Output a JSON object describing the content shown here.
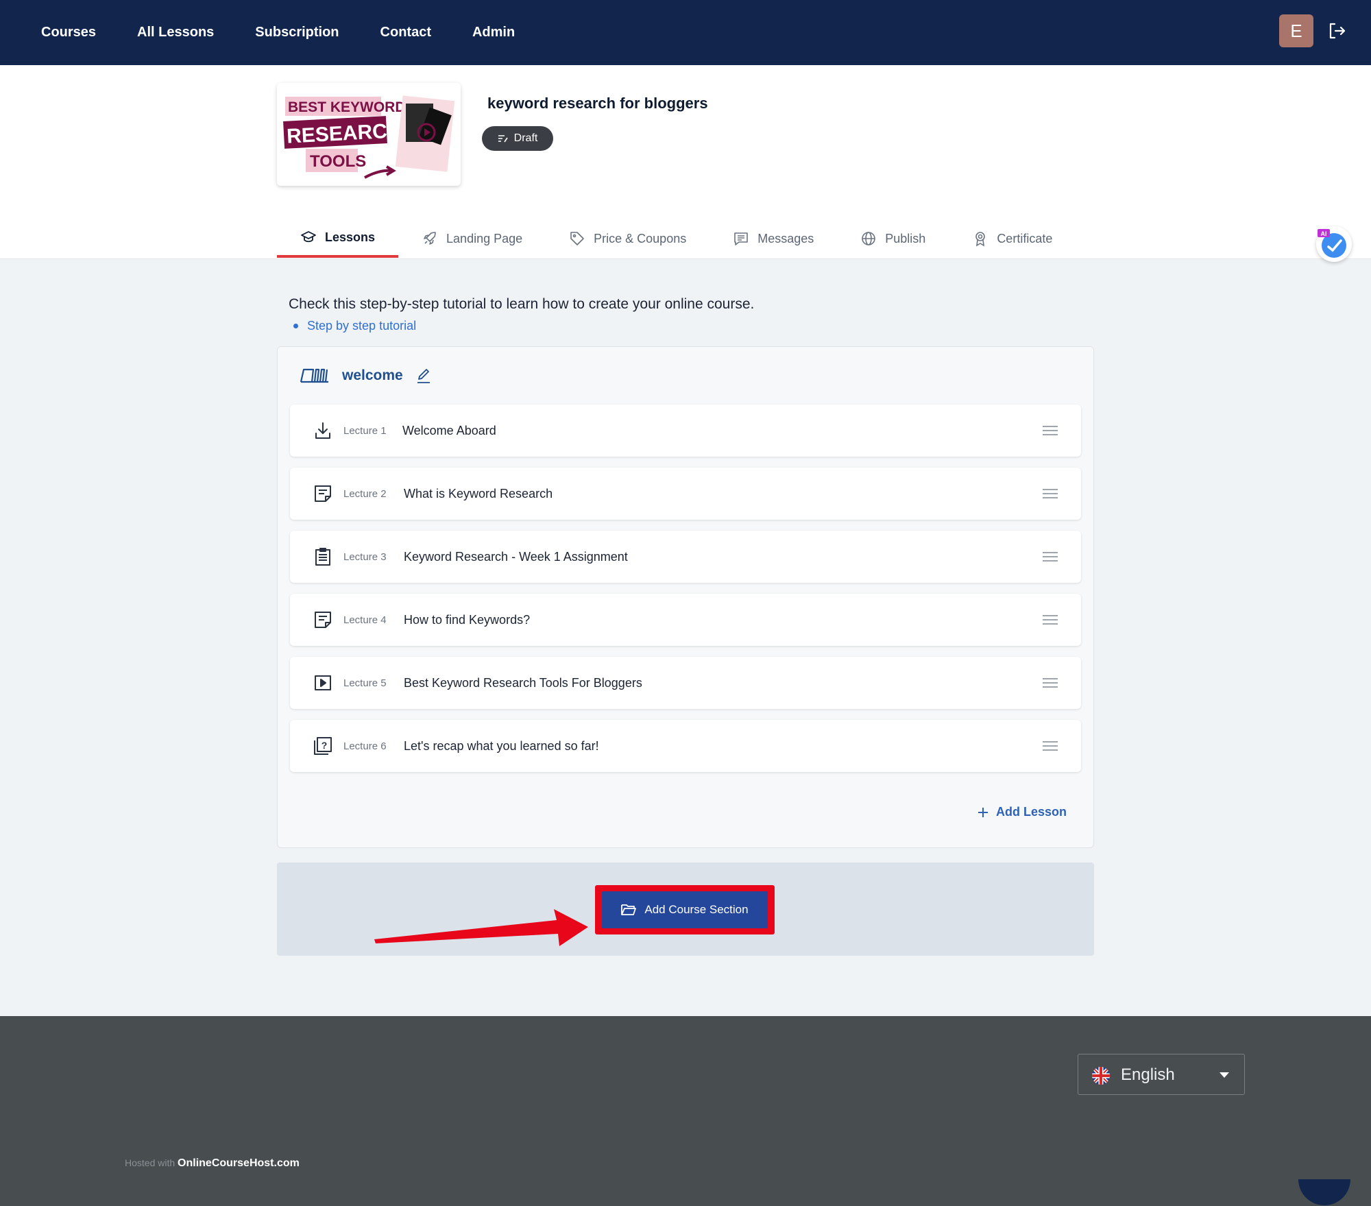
{
  "topnav": {
    "links": [
      "Courses",
      "All Lessons",
      "Subscription",
      "Contact",
      "Admin"
    ],
    "avatar_initial": "E"
  },
  "course": {
    "title": "keyword research for bloggers",
    "status": "Draft",
    "thumbnail_text": [
      "BEST KEYWORD",
      "RESEARCH",
      "TOOLS"
    ]
  },
  "tabs": [
    {
      "label": "Lessons",
      "icon": "graduation-cap-icon",
      "active": true
    },
    {
      "label": "Landing Page",
      "icon": "rocket-icon",
      "active": false
    },
    {
      "label": "Price & Coupons",
      "icon": "tag-icon",
      "active": false
    },
    {
      "label": "Messages",
      "icon": "message-icon",
      "active": false
    },
    {
      "label": "Publish",
      "icon": "globe-icon",
      "active": false
    },
    {
      "label": "Certificate",
      "icon": "award-icon",
      "active": false
    }
  ],
  "ai_badge_label": "AI",
  "intro": {
    "text": "Check this step-by-step tutorial to learn how to create your online course.",
    "link": "Step by step tutorial"
  },
  "section": {
    "name": "welcome",
    "lectures": [
      {
        "num": "Lecture 1",
        "title": "Welcome Aboard",
        "icon": "download-icon"
      },
      {
        "num": "Lecture 2",
        "title": "What is Keyword Research",
        "icon": "text-document-icon"
      },
      {
        "num": "Lecture 3",
        "title": "Keyword Research - Week 1 Assignment",
        "icon": "clipboard-icon"
      },
      {
        "num": "Lecture 4",
        "title": "How to find Keywords?",
        "icon": "text-document-icon"
      },
      {
        "num": "Lecture 5",
        "title": "Best Keyword Research Tools For Bloggers",
        "icon": "video-play-icon"
      },
      {
        "num": "Lecture 6",
        "title": "Let's recap what you learned so far!",
        "icon": "quiz-icon"
      }
    ],
    "add_lesson": "Add Lesson"
  },
  "add_section_button": "Add Course Section",
  "footer": {
    "language": "English",
    "hosted_prefix": "Hosted with",
    "hosted_brand": "OnlineCourseHost.com"
  },
  "colors": {
    "nav_bg": "#12264d",
    "accent_red": "#e03a3e",
    "primary_button": "#24479b",
    "highlight_red": "#e8071a",
    "footer_bg": "#484e50"
  }
}
